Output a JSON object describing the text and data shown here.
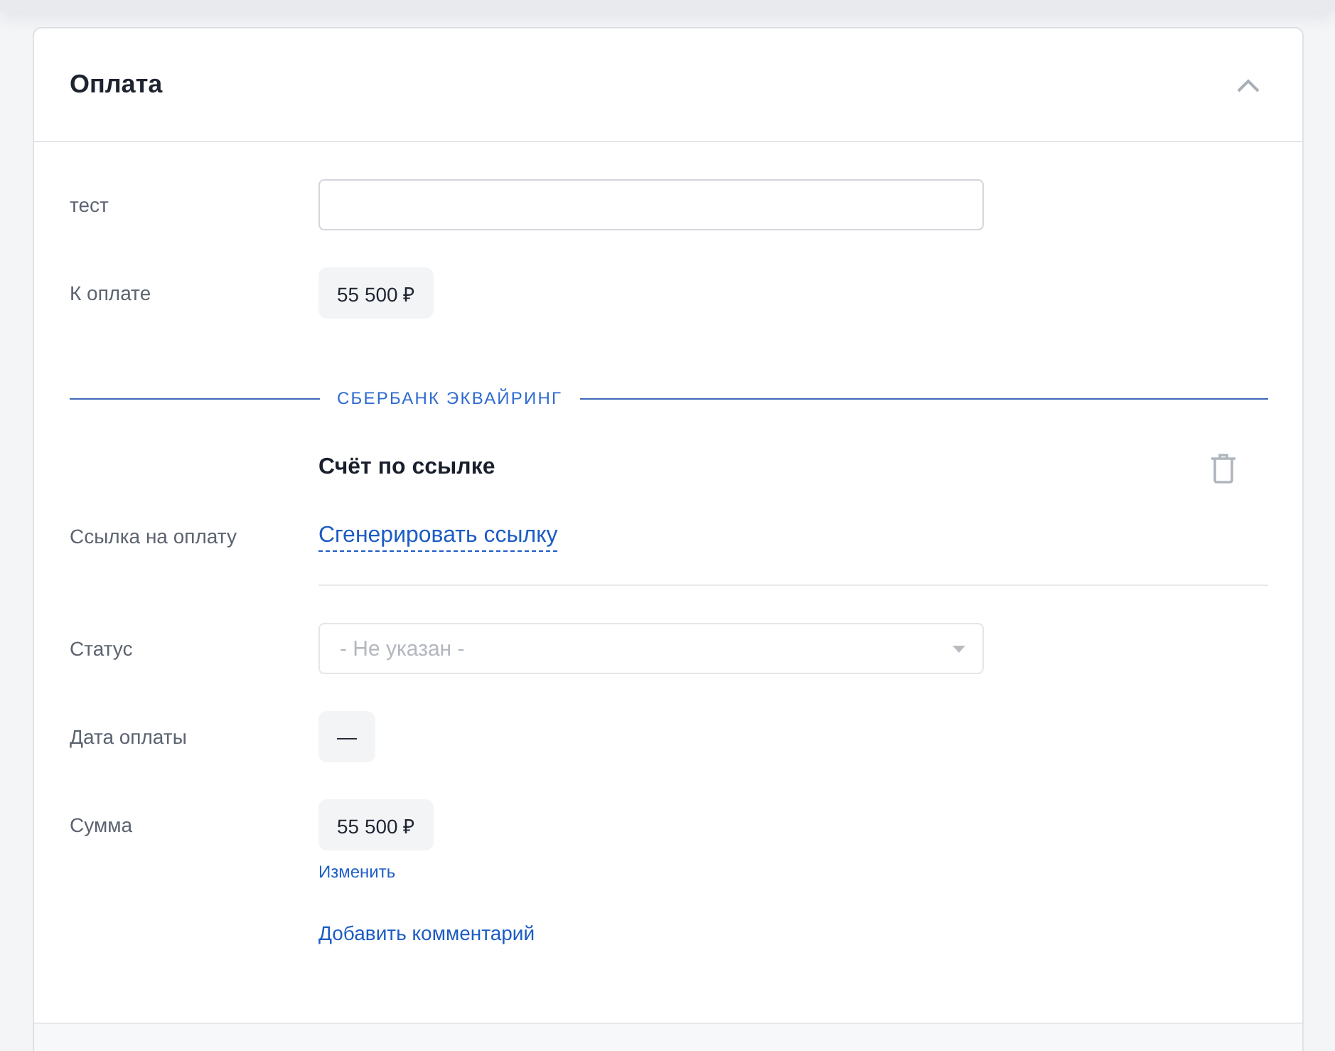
{
  "header": {
    "title": "Оплата",
    "expanded": true
  },
  "fields": [
    {
      "kind": "input",
      "label": "тест"
    },
    {
      "kind": "chip",
      "label": "К оплате",
      "value": "55 500 ₽"
    }
  ],
  "section": {
    "title": "СБЕРБАНК ЭКВАЙРИНГ"
  },
  "invoice": {
    "title": "Счёт по ссылке",
    "link_label": "Ссылка на оплату",
    "link": "Сгенерировать ссылку"
  },
  "details": [
    {
      "kind": "select",
      "label": "Статус",
      "placeholder": "- Не указан -"
    },
    {
      "kind": "chip",
      "label": "Дата оплаты",
      "value": "—"
    },
    {
      "kind": "chip",
      "label": "Сумма",
      "value": "55 500 ₽",
      "action": "Изменить"
    }
  ],
  "comment_link": "Добавить комментарий"
}
